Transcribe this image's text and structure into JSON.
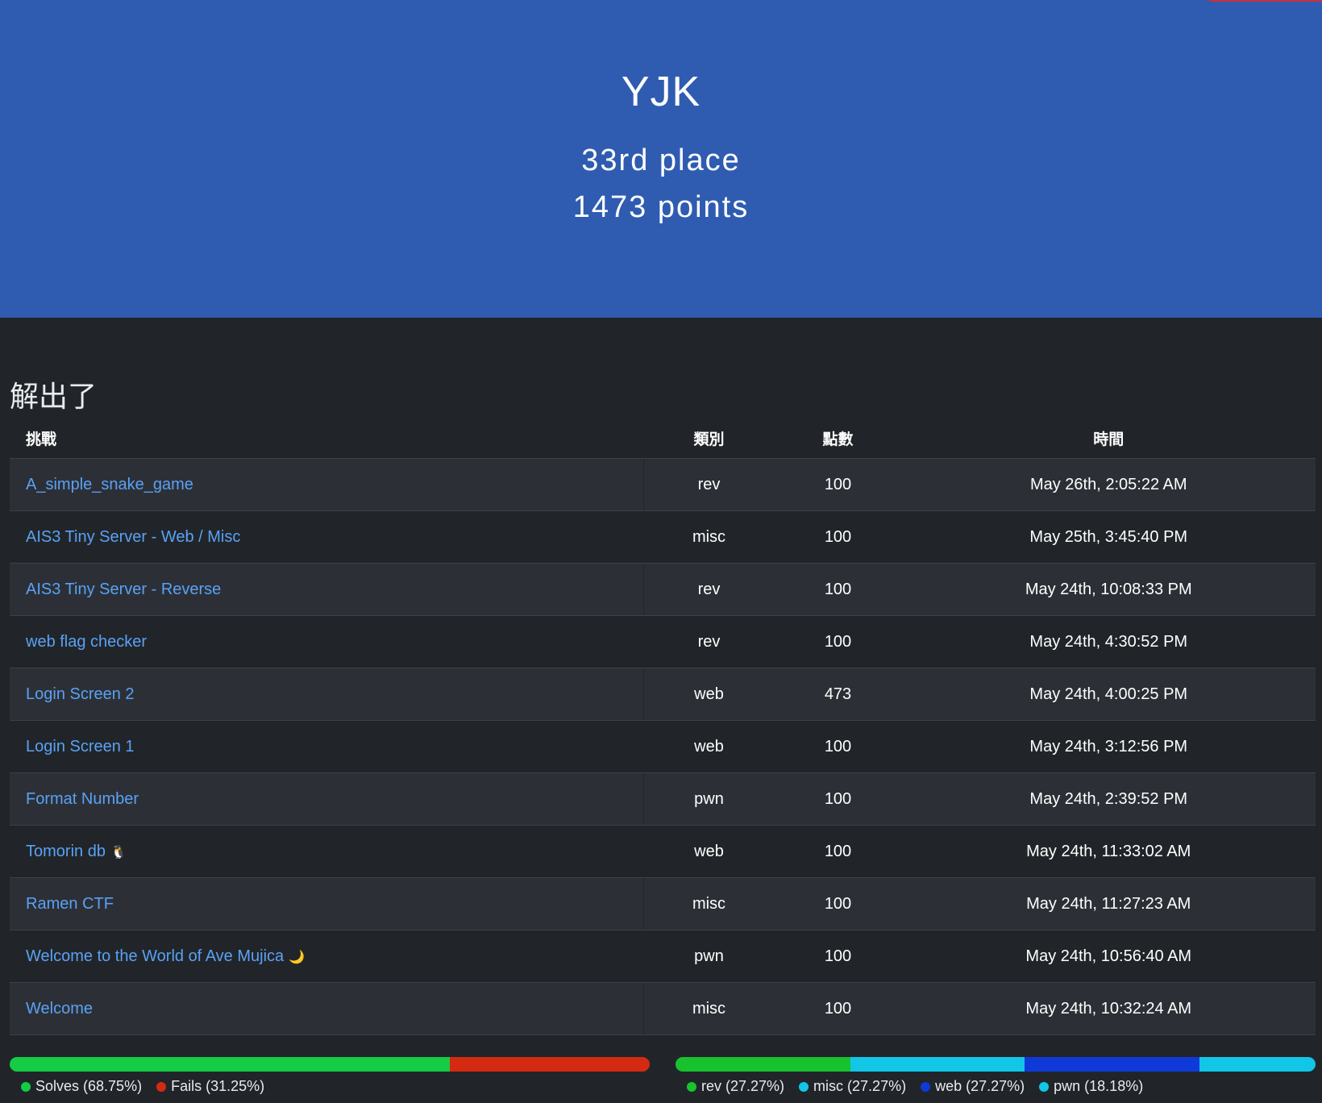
{
  "hero": {
    "team_name": "YJK",
    "place": "33rd place",
    "points": "1473 points",
    "background": "#2f5cb1"
  },
  "solves_section": {
    "title": "解出了",
    "columns": [
      "挑戰",
      "類別",
      "點數",
      "時間"
    ],
    "rows": [
      {
        "name": "A_simple_snake_game",
        "category": "rev",
        "points": "100",
        "time": "May 26th, 2:05:22 AM"
      },
      {
        "name": "AIS3 Tiny Server - Web / Misc",
        "category": "misc",
        "points": "100",
        "time": "May 25th, 3:45:40 PM"
      },
      {
        "name": "AIS3 Tiny Server - Reverse",
        "category": "rev",
        "points": "100",
        "time": "May 24th, 10:08:33 PM"
      },
      {
        "name": "web flag checker",
        "category": "rev",
        "points": "100",
        "time": "May 24th, 4:30:52 PM"
      },
      {
        "name": "Login Screen 2",
        "category": "web",
        "points": "473",
        "time": "May 24th, 4:00:25 PM"
      },
      {
        "name": "Login Screen 1",
        "category": "web",
        "points": "100",
        "time": "May 24th, 3:12:56 PM"
      },
      {
        "name": "Format Number",
        "category": "pwn",
        "points": "100",
        "time": "May 24th, 2:39:52 PM"
      },
      {
        "name": "Tomorin db",
        "emoji": "🐧",
        "category": "web",
        "points": "100",
        "time": "May 24th, 11:33:02 AM"
      },
      {
        "name": "Ramen CTF",
        "category": "misc",
        "points": "100",
        "time": "May 24th, 11:27:23 AM"
      },
      {
        "name": "Welcome to the World of Ave Mujica",
        "emoji": "🌙",
        "category": "pwn",
        "points": "100",
        "time": "May 24th, 10:56:40 AM"
      },
      {
        "name": "Welcome",
        "category": "misc",
        "points": "100",
        "time": "May 24th, 10:32:24 AM"
      }
    ]
  },
  "solve_fail_bar": {
    "segments": [
      {
        "label": "Solves (68.75%)",
        "percent": 68.75,
        "color": "#14cc45"
      },
      {
        "label": "Fails (31.25%)",
        "percent": 31.25,
        "color": "#d42a12"
      }
    ]
  },
  "category_bar": {
    "segments": [
      {
        "label": "rev (27.27%)",
        "percent": 27.27,
        "color": "#18c22e"
      },
      {
        "label": "misc (27.27%)",
        "percent": 27.27,
        "color": "#12c6e8"
      },
      {
        "label": "web (27.27%)",
        "percent": 27.27,
        "color": "#0f3ad9"
      },
      {
        "label": "pwn (18.18%)",
        "percent": 18.18,
        "color": "#12c6e8"
      }
    ]
  }
}
